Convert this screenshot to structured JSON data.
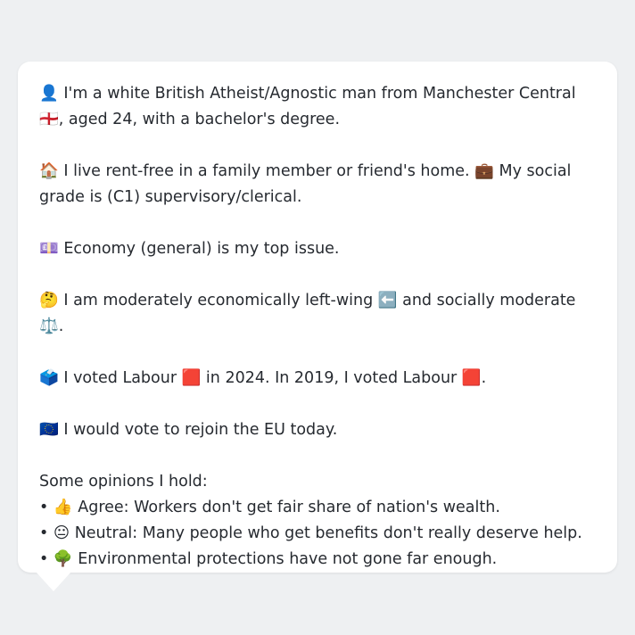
{
  "profile": {
    "intro": "👤 I'm a white British Atheist/Agnostic man from Manchester Central 🏴󠁧󠁢󠁥󠁮󠁧󠁿, aged 24, with a bachelor's degree.",
    "housing": "🏠 I live rent-free in a family member or friend's home. 💼 My social grade is (C1) supervisory/clerical.",
    "top_issue": "💷 Economy (general) is my top issue.",
    "ideology": "🤔 I am moderately economically left-wing ⬅️ and socially moderate ⚖️.",
    "voting": "🗳️ I voted Labour 🟥 in 2024. In 2019, I voted Labour 🟥.",
    "eu": "🇪🇺 I would vote to rejoin the EU today.",
    "opinions_title": "Some opinions I hold:",
    "opinions": [
      "• 👍 Agree: Workers don't get fair share of nation's wealth.",
      "• 😐 Neutral: Many people who get benefits don't really deserve help.",
      "• 🌳 Environmental protections have not gone far enough."
    ]
  }
}
